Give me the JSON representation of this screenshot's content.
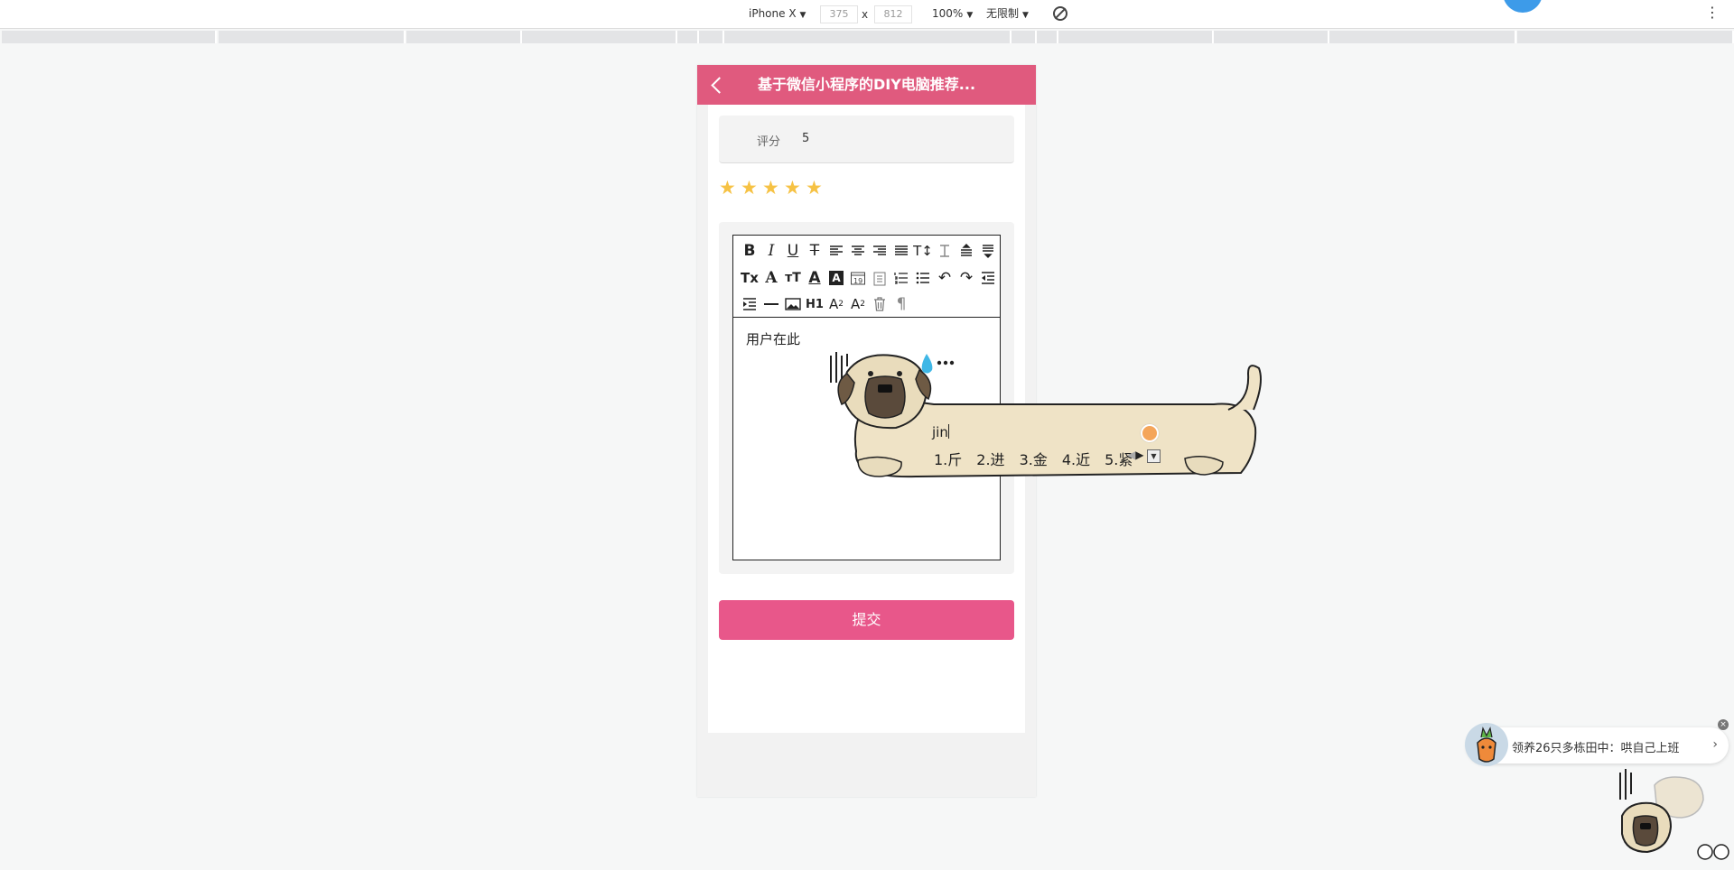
{
  "devtools": {
    "device": "iPhone X",
    "width": "375",
    "times": "x",
    "height": "812",
    "zoom": "100%",
    "throttle": "无限制",
    "rotate_icon": "rotate-icon",
    "more_icon": "more-icon"
  },
  "navbar": {
    "title": "基于微信小程序的DIY电脑推荐...",
    "back_icon": "chevron-left-icon",
    "color": "#e05a7e"
  },
  "form": {
    "score_label": "评分",
    "score_value": "5",
    "rating": 5,
    "rating_max": 5,
    "star_color": "#f6c244",
    "editor_content": "用户在此",
    "submit_label": "提交",
    "submit_color": "#e8578a"
  },
  "editor_toolbar": {
    "row1": [
      "bold-icon",
      "italic-icon",
      "underline-icon",
      "strikethrough-icon",
      "align-left-icon",
      "align-center-icon",
      "align-right-icon",
      "align-justify-icon",
      "font-size-icon",
      "line-height-icon",
      "space-before-icon",
      "space-after-icon"
    ],
    "row2": [
      "clear-format-icon",
      "font-icon",
      "font-small-icon",
      "font-color-icon",
      "background-color-icon",
      "date-icon",
      "clipboard-icon",
      "ordered-list-icon",
      "unordered-list-icon",
      "undo-icon",
      "redo-icon",
      "outdent-icon"
    ],
    "row3": [
      "indent-icon",
      "horizontal-rule-icon",
      "image-icon",
      "header-icon",
      "subscript-icon",
      "superscript-icon",
      "delete-icon",
      "paragraph-icon"
    ],
    "h1_label": "H1"
  },
  "ime": {
    "input": "jin",
    "candidates": [
      "1.斤",
      "2.进",
      "3.金",
      "4.近",
      "5.紧"
    ]
  },
  "notification": {
    "text": "领养26只多栋田中：哄自己上班",
    "chevron": "›",
    "close": "×"
  }
}
